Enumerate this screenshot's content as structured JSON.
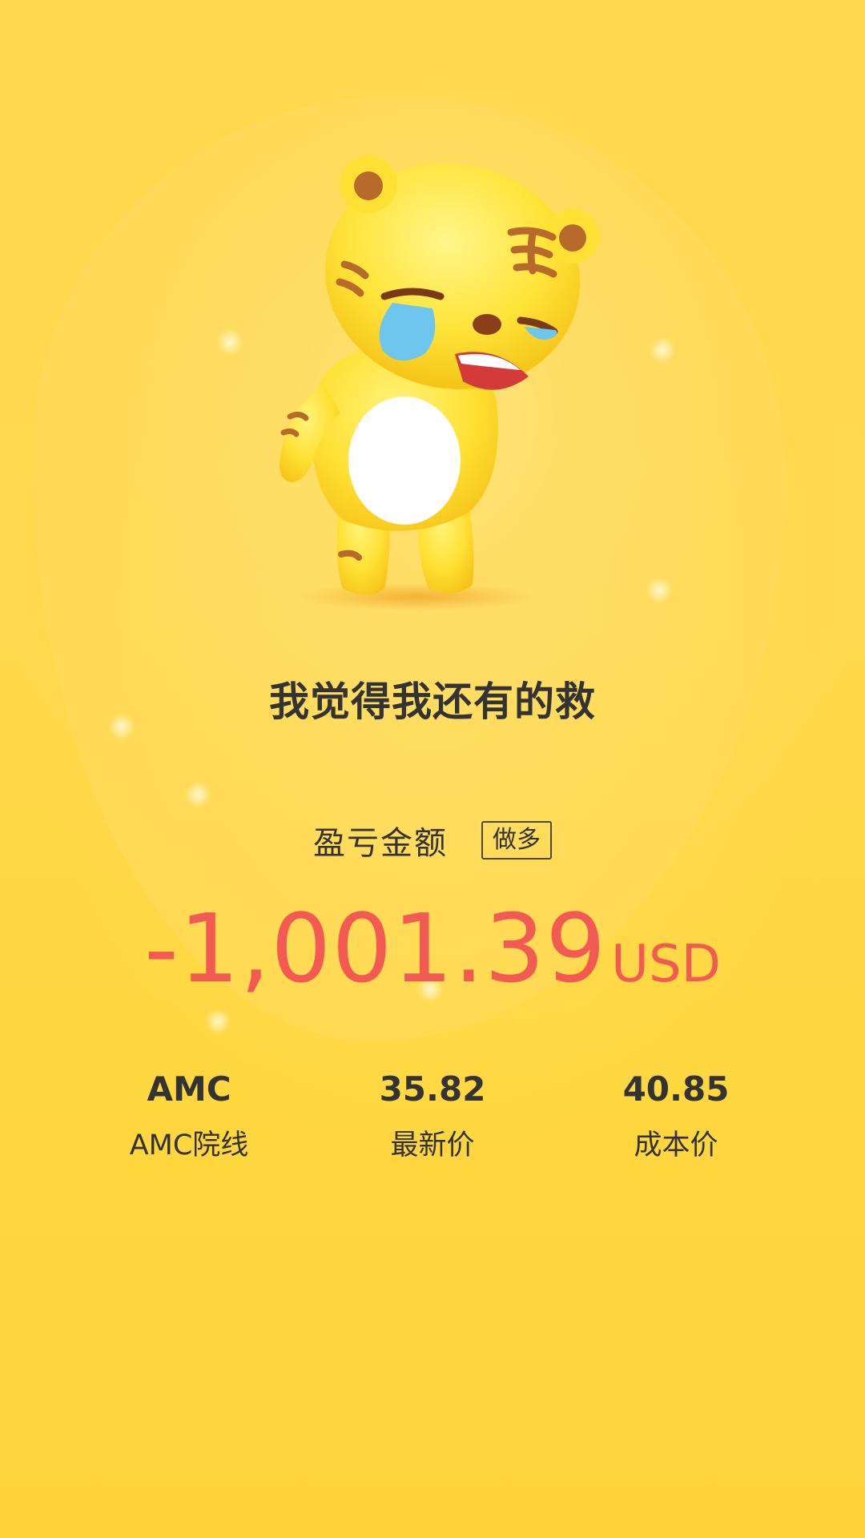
{
  "mascot": {
    "icon": "crying-tiger-mascot-icon"
  },
  "headline": "我觉得我还有的救",
  "profit_loss": {
    "label": "盈亏金额",
    "position_tag": "做多",
    "amount": "-1,001.39",
    "currency": "USD",
    "color": "#f35a53"
  },
  "stats": [
    {
      "value": "AMC",
      "label": "AMC院线"
    },
    {
      "value": "35.82",
      "label": "最新价"
    },
    {
      "value": "40.85",
      "label": "成本价"
    }
  ],
  "colors": {
    "background": "#ffd43f",
    "text": "#333333"
  }
}
